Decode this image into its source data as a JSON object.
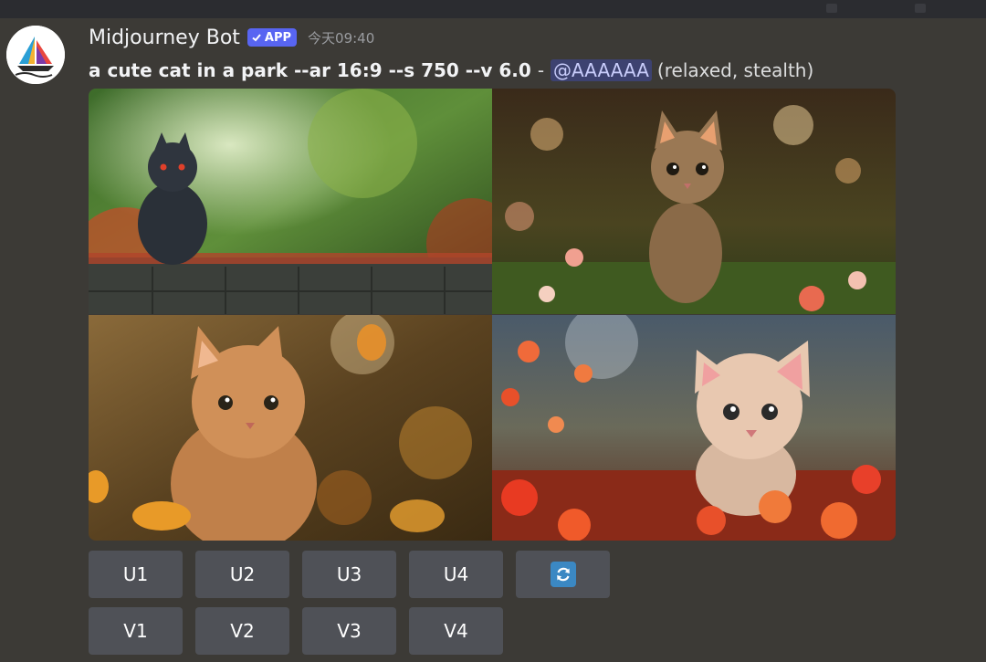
{
  "message": {
    "author": "Midjourney Bot",
    "badge": "APP",
    "timestamp": "今天09:40",
    "prompt": "a cute cat in a park --ar 16:9 --s 750 --v 6.0",
    "separator": "-",
    "mention": "@AAAAAA",
    "suffix": "(relaxed, stealth)"
  },
  "images": [
    {
      "name": "black-cat-on-wall"
    },
    {
      "name": "tabby-kitten-walking"
    },
    {
      "name": "orange-cat-autumn-leaves"
    },
    {
      "name": "kitten-red-flowers"
    }
  ],
  "buttons": {
    "upscale": [
      "U1",
      "U2",
      "U3",
      "U4"
    ],
    "variation": [
      "V1",
      "V2",
      "V3",
      "V4"
    ],
    "reroll_icon": "refresh-icon"
  },
  "colors": {
    "background": "#3c3a36",
    "button": "#4f5157",
    "badge": "#5865f2",
    "mention_bg": "#3d4270",
    "reroll": "#3b88c3"
  }
}
